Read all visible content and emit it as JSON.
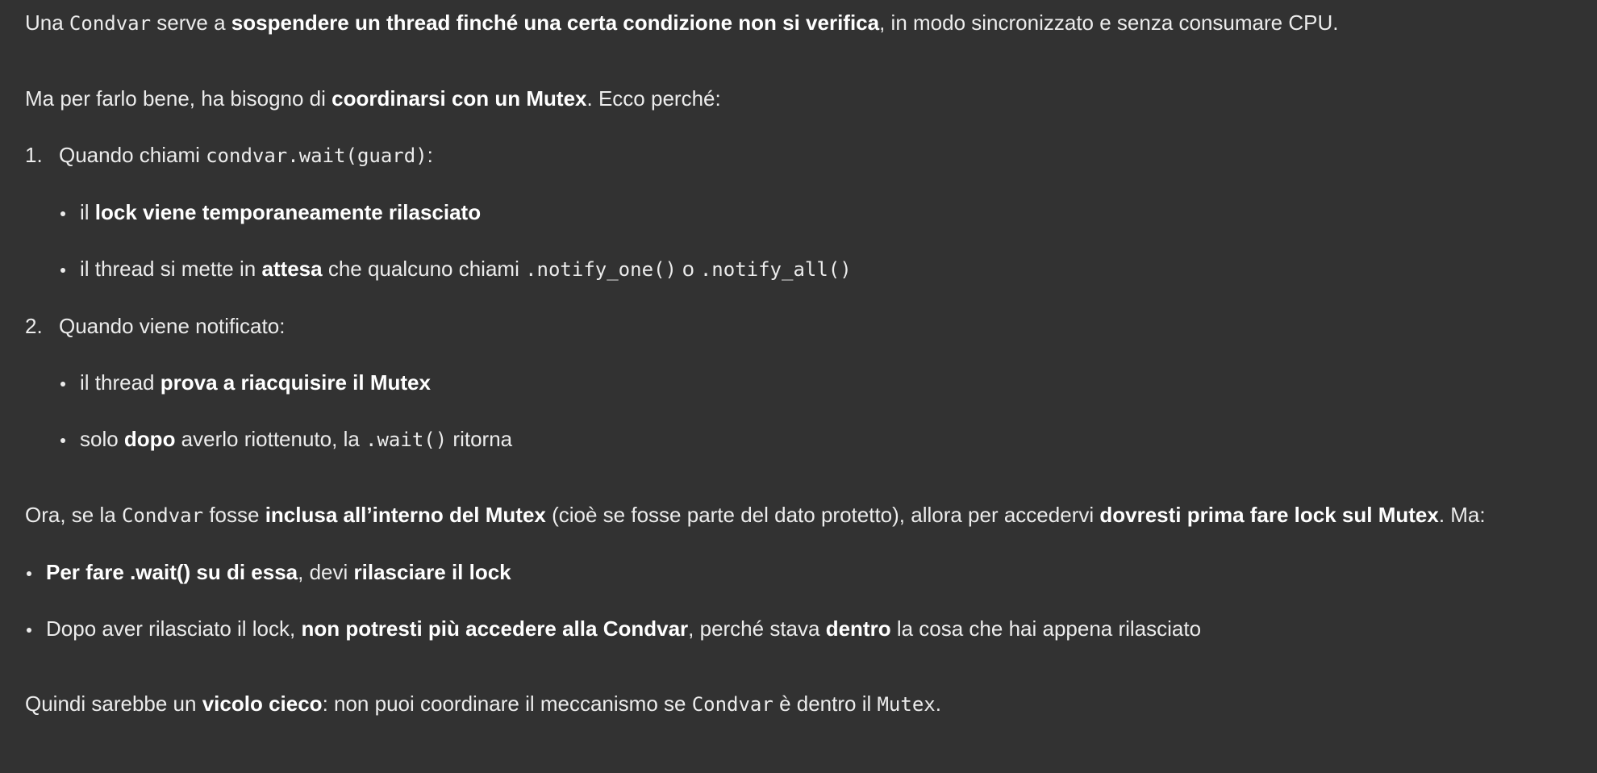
{
  "intro": {
    "t1": "Una ",
    "c1": "Condvar",
    "t2": " serve a ",
    "b1": "sospendere un thread finché una certa condizione non si verifica",
    "t3": ", in modo sincronizzato e senza consumare CPU."
  },
  "ma": {
    "t1": "Ma per farlo bene, ha bisogno di ",
    "b1": "coordinarsi con un Mutex",
    "t2": ". Ecco perché:"
  },
  "step1": {
    "num": "1.",
    "t1": "Quando chiami ",
    "c1": "condvar.wait(guard)",
    "t2": ":",
    "items": [
      {
        "t1": "il ",
        "b1": "lock viene temporaneamente rilasciato"
      },
      {
        "t1": "il thread si mette in ",
        "b1": "attesa",
        "t2": " che qualcuno chiami ",
        "c1": ".notify_one()",
        "t3": " o ",
        "c2": ".notify_all()"
      }
    ]
  },
  "step2": {
    "num": "2.",
    "t1": "Quando viene notificato:",
    "items": [
      {
        "t1": "il thread ",
        "b1": "prova a riacquisire il Mutex"
      },
      {
        "t1": "solo ",
        "b1": "dopo",
        "t2": " averlo riottenuto, la ",
        "c1": ".wait()",
        "t3": " ritorna"
      }
    ]
  },
  "ora": {
    "t1": "Ora, se la ",
    "c1": "Condvar",
    "t2": " fosse ",
    "b1": "inclusa all’interno del Mutex",
    "t3": " (cioè se fosse parte del dato protetto), allora per accedervi ",
    "b2": "dovresti prima fare lock sul Mutex",
    "t4": ". Ma:"
  },
  "bullets": [
    {
      "b1": "Per fare .wait() su di essa",
      "t1": ", devi ",
      "b2": "rilasciare il lock"
    },
    {
      "t1": "Dopo aver rilasciato il lock, ",
      "b1": "non potresti più accedere alla Condvar",
      "t2": ", perché stava ",
      "b2": "dentro",
      "t3": " la cosa che hai appena rilasciato"
    }
  ],
  "conclusion": {
    "t1": "Quindi sarebbe un ",
    "b1": "vicolo cieco",
    "t2": ": non puoi coordinare il meccanismo se ",
    "c1": "Condvar",
    "t3": " è dentro il ",
    "c2": "Mutex",
    "t4": "."
  }
}
